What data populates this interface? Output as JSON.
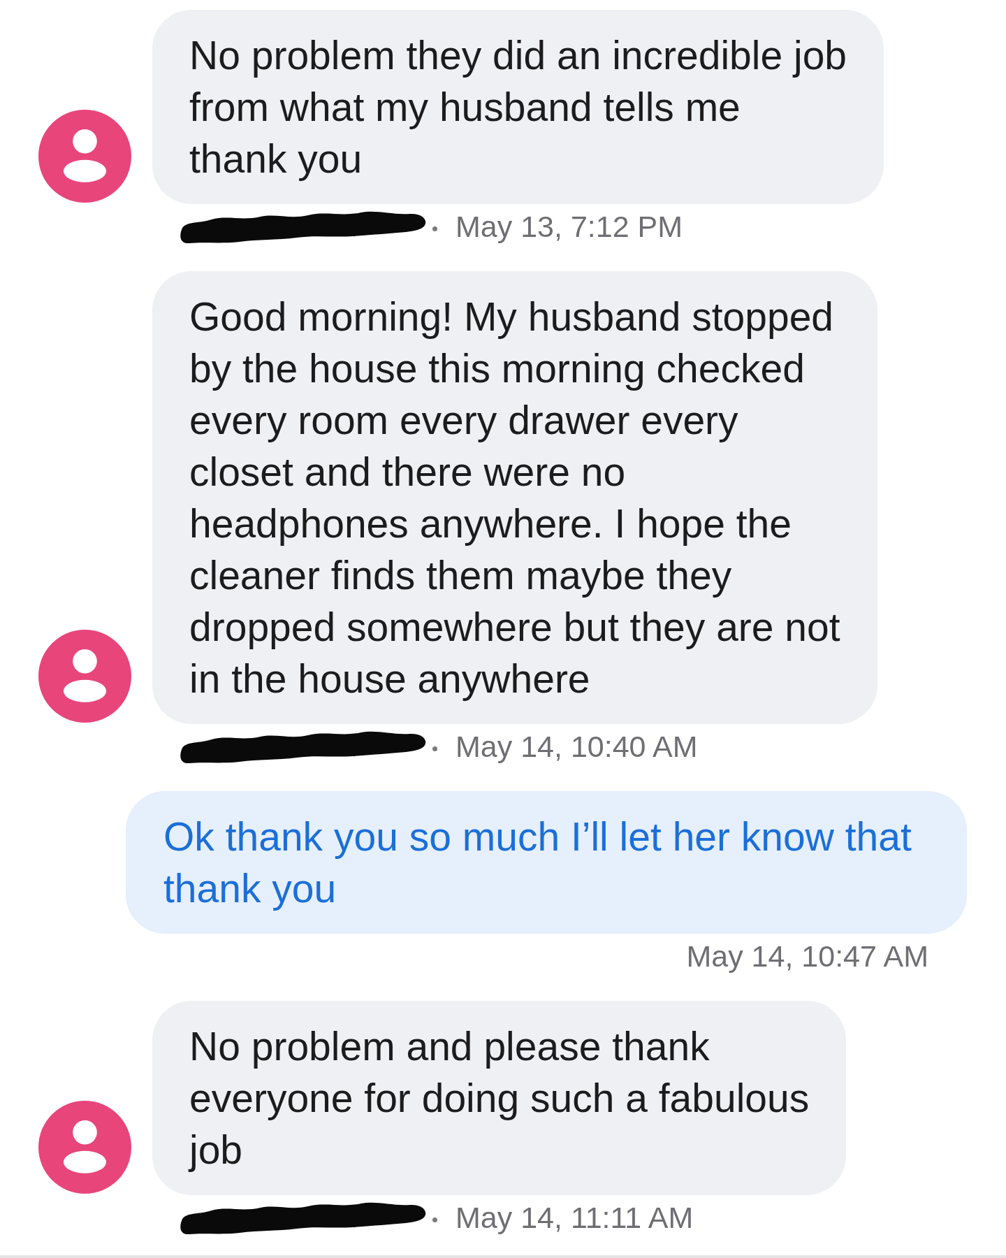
{
  "messages": [
    {
      "kind": "incoming",
      "lines": [
        "No problem they did an incredible job",
        "from what my husband tells me",
        "thank you"
      ],
      "time": "May 13, 7:12 PM"
    },
    {
      "kind": "incoming",
      "lines": [
        "Good morning! My husband stopped",
        "by the house this morning checked",
        "every room every drawer every",
        "closet and there were no",
        "headphones anywhere. I hope the",
        "cleaner finds them maybe they",
        "dropped somewhere but they are not",
        "in the house anywhere"
      ],
      "time": "May 14, 10:40 AM"
    },
    {
      "kind": "outgoing",
      "lines": [
        "Ok thank you so much I’ll let her know that",
        "thank you"
      ],
      "time": "May 14, 10:47 AM"
    },
    {
      "kind": "incoming",
      "lines": [
        "No problem and please thank",
        "everyone for doing such a fabulous",
        "job"
      ],
      "time": "May 14, 11:11 AM"
    }
  ]
}
